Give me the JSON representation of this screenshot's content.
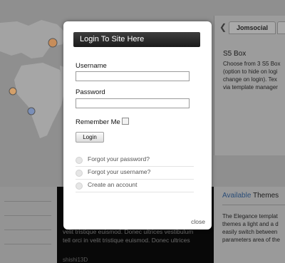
{
  "background": {
    "tabs": {
      "prev_icon": "chevron-left-icon",
      "prev_glyph": "❮",
      "active_label": "Jomsocial"
    },
    "s5_box": {
      "title": "S5 Box",
      "text": "Choose from 3 S5 Box\n(option to hide on logi\nchange on login). Tex\nvia template manager"
    },
    "dark_panel": {
      "text": "velit tristique euismod. Donec ultrices vestibulum\ntell orci in velit tristique euismod. Donec ultrices",
      "footer": "shishi13D"
    },
    "themes": {
      "accent_word": "Available",
      "rest": " Themes",
      "text": "The Elegance templat\nthemes a light and a d\neasily switch between\nparameters area of the"
    }
  },
  "modal": {
    "title": "Login To Site Here",
    "username_label": "Username",
    "username_value": "",
    "password_label": "Password",
    "password_value": "",
    "remember_label": "Remember Me",
    "remember_checked": false,
    "login_button": "Login",
    "links": [
      {
        "label": "Forgot your password?"
      },
      {
        "label": "Forgot your username?"
      },
      {
        "label": "Create an account"
      }
    ],
    "close_label": "close"
  },
  "colors": {
    "overlay": "#8f8f8f",
    "header_bg": "#2a2a2a",
    "accent": "#2a4d78"
  }
}
